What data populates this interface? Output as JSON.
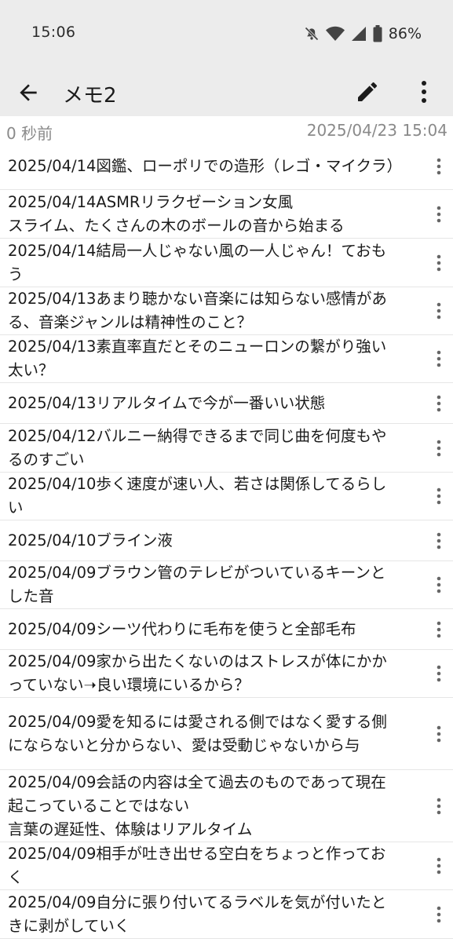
{
  "status_bar": {
    "time": "15:06",
    "icons": [
      "mute-icon",
      "wifi-icon",
      "signal-icon",
      "battery-icon"
    ],
    "battery": "86%"
  },
  "app_bar": {
    "title": "メモ2",
    "icons": [
      "back-arrow-icon",
      "pencil-icon",
      "more-vert-icon"
    ]
  },
  "meta": {
    "saved_ago": "0 秒前",
    "timestamp": "2025/04/23 15:04"
  },
  "colors": {
    "bar_background": "#ececec",
    "meta_text": "#8a8a8a",
    "divider": "#e6e6e6"
  },
  "memos": [
    {
      "text": "2025/04/14図鑑、ローポリでの造形（レゴ・マイクラ）"
    },
    {
      "text": "2025/04/14ASMRリラクゼーション女風\nスライム、たくさんの木のボールの音から始まる"
    },
    {
      "text": "2025/04/14結局一人じゃない風の一人じゃん！ておもう"
    },
    {
      "text": "2025/04/13あまり聴かない音楽には知らない感情がある、音楽ジャンルは精神性のこと？"
    },
    {
      "text": "2025/04/13素直率直だとそのニューロンの繋がり強い太い？"
    },
    {
      "text": "2025/04/13リアルタイムで今が一番いい状態"
    },
    {
      "text": "2025/04/12バルニー納得できるまで同じ曲を何度もやるのすごい"
    },
    {
      "text": "2025/04/10歩く速度が速い人、若さは関係してるらしい"
    },
    {
      "text": "2025/04/10ブライン液"
    },
    {
      "text": "2025/04/09ブラウン管のテレビがついているキーンとした音"
    },
    {
      "text": "2025/04/09シーツ代わりに毛布を使うと全部毛布"
    },
    {
      "text": "2025/04/09家から出たくないのはストレスが体にかかっていない➝良い環境にいるから？"
    },
    {
      "text": "2025/04/09愛を知るには愛される側ではなく愛する側にならないと分からない、愛は受動じゃないから与"
    },
    {
      "text": "2025/04/09会話の内容は全て過去のものであって現在起こっていることではない\n言葉の遅延性、体験はリアルタイム"
    },
    {
      "text": "2025/04/09相手が吐き出せる空白をちょっと作っておく"
    },
    {
      "text": "2025/04/09自分に張り付いてるラベルを気が付いたときに剥がしていく"
    }
  ]
}
